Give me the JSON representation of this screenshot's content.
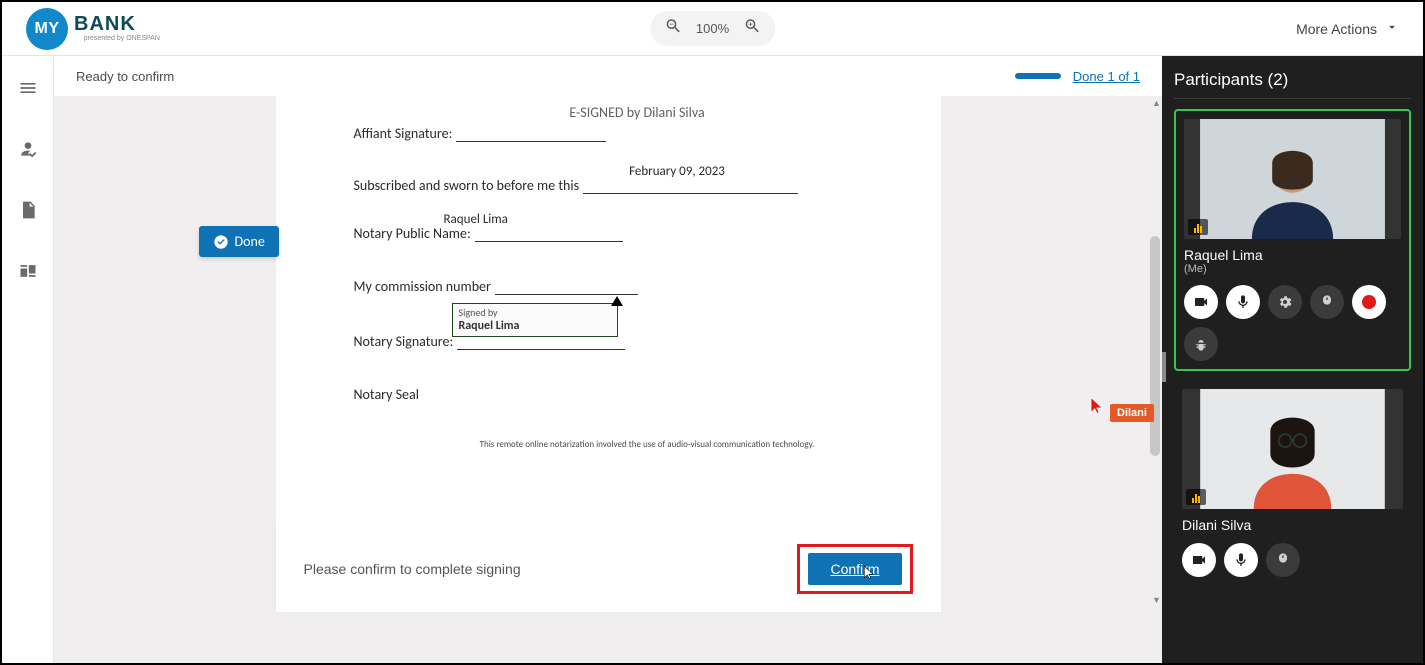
{
  "brand": {
    "circle": "MY",
    "text": "BANK",
    "sub": "presented by ONESPAN"
  },
  "topbar": {
    "zoom": "100%",
    "moreActions": "More Actions"
  },
  "status": {
    "ready": "Ready to confirm",
    "doneLink": "Done 1 of 1"
  },
  "document": {
    "esigned": "E-SIGNED by Dilani Silva",
    "affiantLabel": "Affiant Signature:",
    "date": "February 09, 2023",
    "subscribed": "Subscribed and sworn to before me this",
    "notaryNameOver": "Raquel Lima",
    "notaryNameLabel": "Notary Public Name:",
    "commissionLabel": "My commission number",
    "signBox": {
      "line1": "Signed by",
      "line2": "Raquel Lima"
    },
    "notarySigLabel": "Notary Signature:",
    "sealLabel": "Notary Seal",
    "techNote": "This remote online notarization involved the use of audio-visual communication technology."
  },
  "doneButton": "Done",
  "confirm": {
    "msg": "Please confirm to complete signing",
    "button": "Confirm"
  },
  "remoteCursor": {
    "tag": "Dilani"
  },
  "participants": {
    "title": "Participants (2)",
    "p1": {
      "name": "Raquel Lima",
      "sub": "(Me)"
    },
    "p2": {
      "name": "Dilani Silva"
    }
  },
  "colors": {
    "primary": "#0e72b5",
    "accent": "#e45a26",
    "activeBorder": "#37c451"
  }
}
